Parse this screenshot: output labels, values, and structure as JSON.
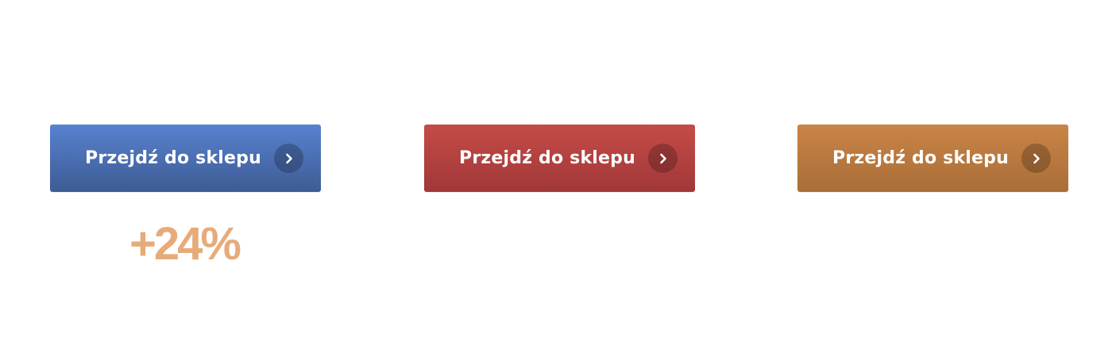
{
  "buttons": [
    {
      "label": "Przejdź do sklepu",
      "color_top": "#5782cf",
      "color_bottom": "#3e5b94",
      "icon": "chevron-right-icon"
    },
    {
      "label": "Przejdź do sklepu",
      "color_top": "#c54b47",
      "color_bottom": "#a03838",
      "icon": "chevron-right-icon"
    },
    {
      "label": "Przejdź do sklepu",
      "color_top": "#c98446",
      "color_bottom": "#a96e38",
      "icon": "chevron-right-icon"
    }
  ],
  "stat": {
    "value": "+24%",
    "color": "#e7ab7a"
  }
}
